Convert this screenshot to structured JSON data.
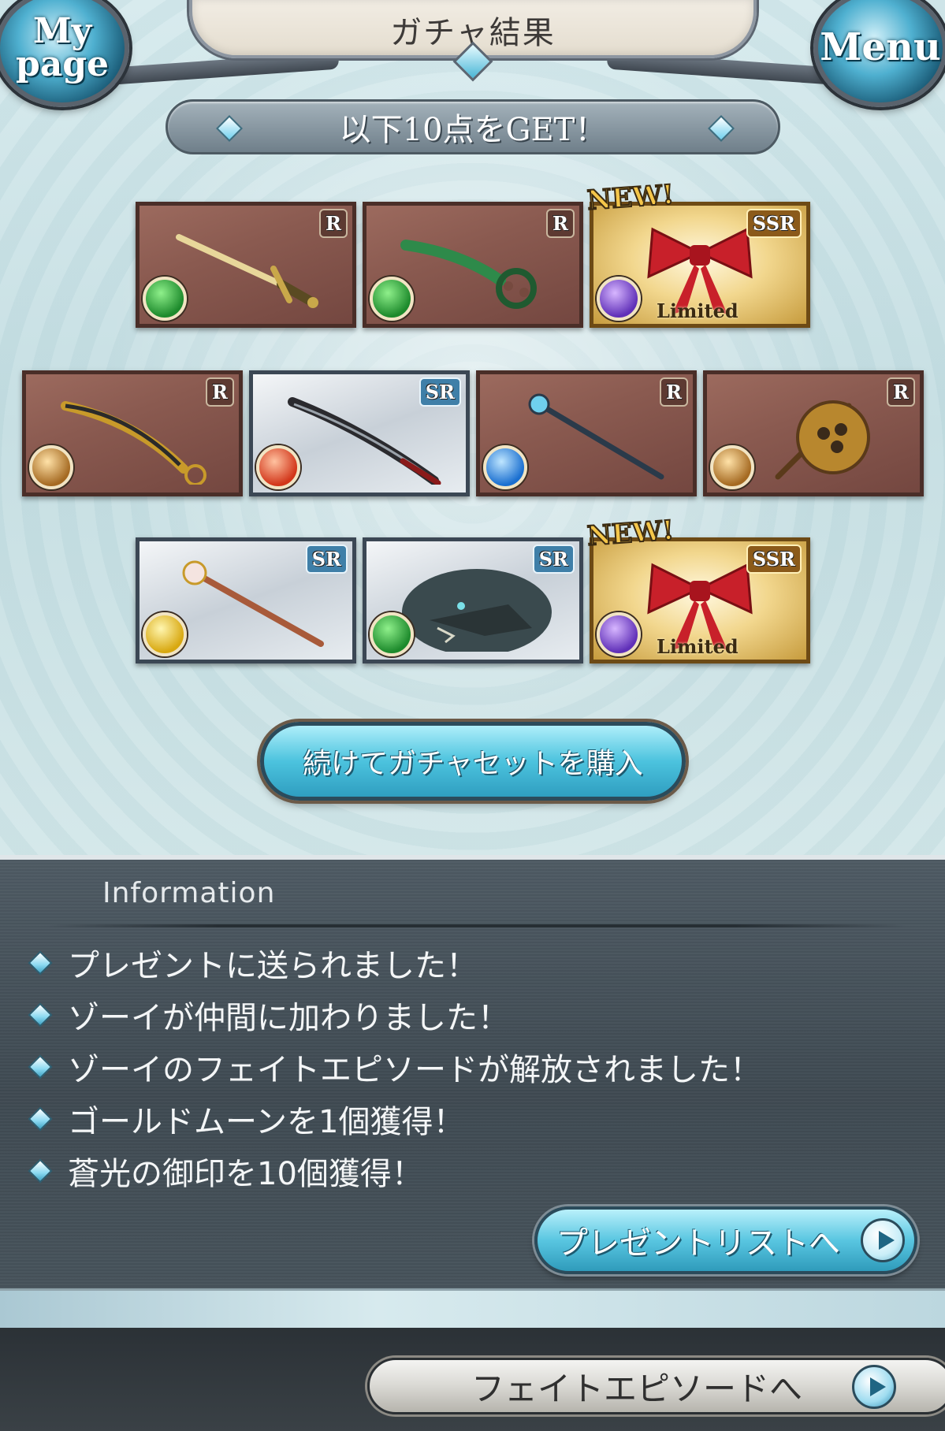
{
  "header": {
    "title": "ガチャ結果",
    "mypage_label": "My\npage",
    "menu_label": "Menu"
  },
  "banner": {
    "text": "以下10点をGET！"
  },
  "items": {
    "row1": [
      {
        "rarity": "R",
        "element": "wind-icon",
        "art": "dagger",
        "new": "",
        "limited": ""
      },
      {
        "rarity": "R",
        "element": "wind-icon",
        "art": "knuckle-blade",
        "new": "",
        "limited": ""
      },
      {
        "rarity": "SSR",
        "element": "dark-icon",
        "art": "red-ribbon",
        "new": "NEW!",
        "limited": "Limited"
      }
    ],
    "row2": [
      {
        "rarity": "R",
        "element": "earth-icon",
        "art": "scimitar",
        "new": "",
        "limited": ""
      },
      {
        "rarity": "SR",
        "element": "fire-icon",
        "art": "dark-katana",
        "new": "",
        "limited": ""
      },
      {
        "rarity": "R",
        "element": "water-icon",
        "art": "staff",
        "new": "",
        "limited": ""
      },
      {
        "rarity": "R",
        "element": "earth-icon",
        "art": "axe",
        "new": "",
        "limited": ""
      }
    ],
    "row3": [
      {
        "rarity": "SR",
        "element": "light-icon",
        "art": "orb-staff",
        "new": "",
        "limited": ""
      },
      {
        "rarity": "SR",
        "element": "wind-icon",
        "art": "dragon-summon",
        "new": "",
        "limited": ""
      },
      {
        "rarity": "SSR",
        "element": "dark-icon",
        "art": "red-ribbon",
        "new": "NEW!",
        "limited": "Limited"
      }
    ]
  },
  "continue_button": {
    "label": "続けてガチャセットを購入"
  },
  "information": {
    "heading": "Information",
    "messages": [
      "プレゼントに送られました！",
      "ゾーイが仲間に加わりました！",
      "ゾーイのフェイトエピソードが解放されました！",
      "ゴールドムーンを1個獲得！",
      "蒼光の御印を10個獲得！"
    ],
    "present_list_button": "プレゼントリストへ"
  },
  "bottom": {
    "fate_episode_button": "フェイトエピソードへ"
  },
  "colors": {
    "accent": "#4cc3de",
    "panel": "#47535b",
    "rarity_R": "#8a5a50",
    "rarity_SR": "#c8d0d8",
    "rarity_SSR": "#f2d78e"
  }
}
